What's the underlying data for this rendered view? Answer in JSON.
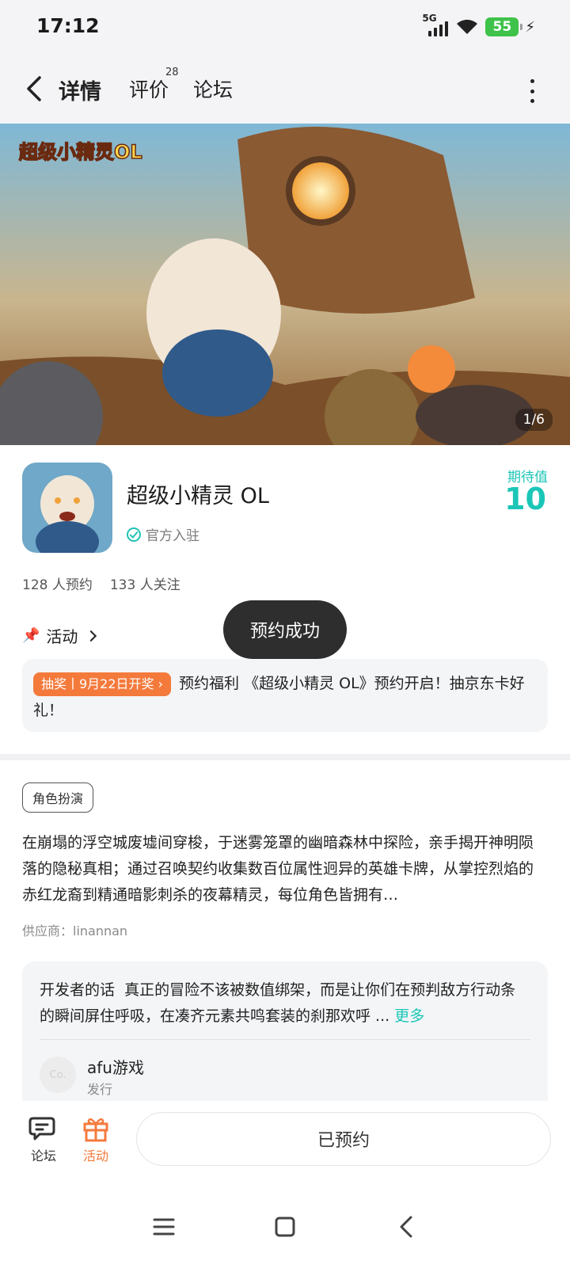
{
  "status_bar": {
    "time": "17:12",
    "network": "5G",
    "battery": "55",
    "icons": [
      "signal-icon",
      "wifi-icon",
      "battery-icon",
      "charging-icon"
    ]
  },
  "nav": {
    "tabs": [
      {
        "label": "详情",
        "active": true
      },
      {
        "label": "评价",
        "badge": "28"
      },
      {
        "label": "论坛"
      }
    ],
    "accent_color": "#1bc6b7"
  },
  "banner": {
    "logo_text": "超级小精灵OL",
    "counter": "1/6"
  },
  "game": {
    "title": "超级小精灵 OL",
    "official_label": "官方入驻",
    "expect_label": "期待值",
    "expect_value": "10",
    "reservations": "128 人预约",
    "followers": "133 人关注"
  },
  "activity": {
    "header": "活动",
    "tag": "抽奖丨9月22日开奖",
    "text": "预约福利 《超级小精灵 OL》预约开启！抽京东卡好礼！",
    "tag_color": "#f47a3c"
  },
  "toast": "预约成功",
  "details": {
    "genre": "角色扮演",
    "description": "在崩塌的浮空城废墟间穿梭，于迷雾笼罩的幽暗森林中探险，亲手揭开神明陨落的隐秘真相；通过召唤契约收集数百位属性迥异的英雄卡牌，从掌控烈焰的赤红龙裔到精通暗影刺杀的夜幕精灵，每位角色皆拥有…",
    "supplier": "供应商：linannan"
  },
  "developer": {
    "label": "开发者的话",
    "text": "真正的冒险不该被数值绑架，而是让你们在预判敌方行动条的瞬间屏住呼吸，在凑齐元素共鸣套装的刹那欢呼 ...",
    "more": "更多",
    "avatar_text": "Co.",
    "name": "afu游戏",
    "role": "发行"
  },
  "bottom_bar": {
    "forum": "论坛",
    "activity": "活动",
    "reserved": "已预约"
  }
}
